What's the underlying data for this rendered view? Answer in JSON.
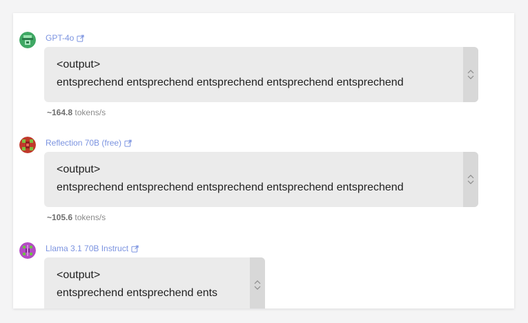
{
  "entries": [
    {
      "model": "GPT-4o",
      "output_tag": "<output>",
      "output_text": "entsprechend entsprechend entsprechend entsprechend entsprechend",
      "speed_value": "~164.8",
      "speed_unit": "tokens/s"
    },
    {
      "model": "Reflection 70B (free)",
      "output_tag": "<output>",
      "output_text": "entsprechend entsprechend entsprechend entsprechend entsprechend",
      "speed_value": "~105.6",
      "speed_unit": "tokens/s"
    },
    {
      "model": "Llama 3.1 70B Instruct",
      "output_tag": "<output>",
      "output_text": "entsprechend entsprechend ents"
    }
  ],
  "colors": {
    "link": "#7b93e0",
    "box_bg": "#ebebeb",
    "scroll_strip": "#d8d8d8",
    "avatar_gpt": "#3fa864",
    "avatar_reflection": "#c0392b",
    "avatar_llama": "#b44bc4"
  },
  "icons": [
    "external-link-icon",
    "up-down-chevron-icon"
  ]
}
